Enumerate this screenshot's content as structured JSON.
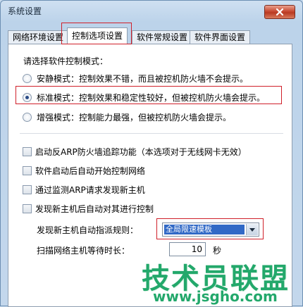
{
  "window": {
    "title": "系统设置"
  },
  "tabs": [
    {
      "label": "网络环境设置"
    },
    {
      "label": "控制选项设置"
    },
    {
      "label": "软件常规设置"
    },
    {
      "label": "软件界面设置"
    }
  ],
  "control_mode": {
    "prompt": "请选择软件控制模式：",
    "options": [
      {
        "label": "安静模式：控制效果不错，而且被控机防火墙不会提示。"
      },
      {
        "label": "标准模式：控制效果和稳定性较好，但被控机防火墙会提示。"
      },
      {
        "label": "增强模式：控制能力最强，但被控机防火墙会提示。"
      }
    ]
  },
  "checkboxes": [
    {
      "label": "启动反ARP防火墙追踪功能（本选项对于无线网卡无效）"
    },
    {
      "label": "软件启动后自动开始控制网络"
    },
    {
      "label": "通过监测ARP请求发现新主机"
    },
    {
      "label": "发现新主机后自动对其进行控制"
    }
  ],
  "auto_rule": {
    "label": "发现新主机自动指派规则：",
    "value": "全局限速模板"
  },
  "scan_wait": {
    "label": "扫描网络主机等待时长：",
    "value": "10",
    "unit": "秒"
  },
  "watermark": {
    "title": "技术员联盟",
    "url": "www.jsgho.com"
  }
}
